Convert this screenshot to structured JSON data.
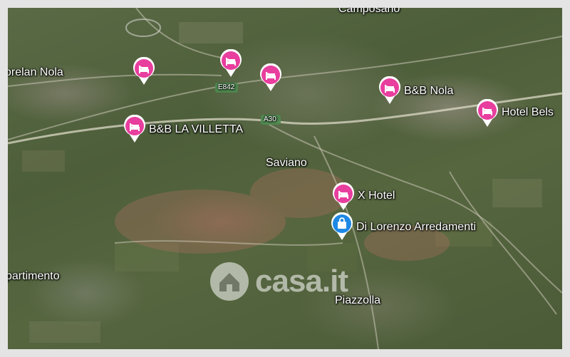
{
  "colors": {
    "hotel_pin": "#e83e9e",
    "shop_pin": "#1e88e5",
    "frame": "#e4e4e4"
  },
  "places": {
    "camposano": "Camposano",
    "morelan_nola": "orelan Nola",
    "saviano": "Saviano",
    "piazzolla": "Piazzolla",
    "dipartimento": "partimento"
  },
  "pins": {
    "bb_nola": "B&B Nola",
    "hotel_bels": "Hotel Bels",
    "bb_la_villetta": "B&B LA VILLETTA",
    "x_hotel": "X Hotel",
    "di_lorenzo": "Di Lorenzo Arredamenti"
  },
  "roads": {
    "e842": "E842",
    "a30": "A30"
  },
  "pin_icons": {
    "hotel": "bed-icon",
    "shop": "shopping-bag-icon"
  },
  "watermark": {
    "text": "casa.it",
    "icon": "house-icon"
  }
}
